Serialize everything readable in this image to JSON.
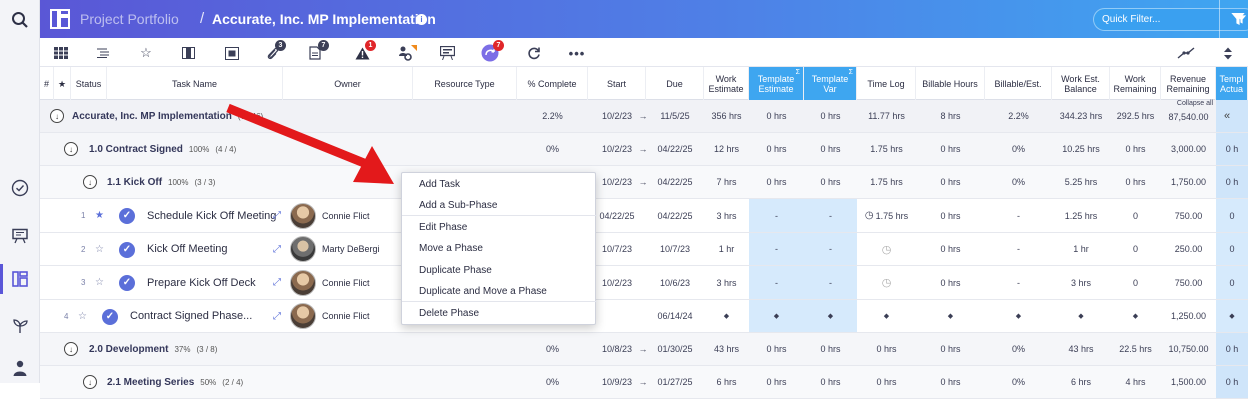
{
  "header": {
    "breadcrumb_root": "Project Portfolio",
    "separator": "/",
    "title": "Accurate, Inc. MP Implementation",
    "quick_filter_placeholder": "Quick Filter..."
  },
  "toolbar": {
    "badges": {
      "attachments": "3",
      "notes": "7",
      "risks": "1",
      "sync": "7"
    }
  },
  "columns": {
    "hash": "#",
    "star": "★",
    "status": "Status",
    "task_name": "Task Name",
    "owner": "Owner",
    "resource_type": "Resource Type",
    "pct_complete": "% Complete",
    "start": "Start",
    "due": "Due",
    "work_estimate": "Work Estimate",
    "template_estimate": "Template Estimate",
    "template_var": "Template Var",
    "time_log": "Time Log",
    "billable_hours": "Billable Hours",
    "billable_est": "Billable/Est.",
    "work_est_balance": "Work Est. Balance",
    "work_remaining": "Work Remaining",
    "revenue_remaining": "Revenue Remaining",
    "template_actual": "Templ Actua"
  },
  "project_row": {
    "name": "Accurate, Inc. MP Implementation",
    "counts": "(7 / 46)",
    "pct": "2.2%",
    "start": "10/2/23",
    "due": "11/5/25",
    "work_est": "356 hrs",
    "tpl_est": "0 hrs",
    "tpl_var": "0 hrs",
    "time_log": "11.77 hrs",
    "billable": "8 hrs",
    "billable_est": "2.2%",
    "balance": "344.23 hrs",
    "remaining": "292.5 hrs",
    "revenue": "87,540.00",
    "collapse_all": "Collapse all",
    "tpl_actual": "0"
  },
  "phases": [
    {
      "name": "1.0 Contract Signed",
      "pct_inline": "100%",
      "counts": "(4 / 4)",
      "pct": "0%",
      "start": "10/2/23",
      "due": "04/22/25",
      "work_est": "12 hrs",
      "tpl_est": "0 hrs",
      "tpl_var": "0 hrs",
      "time_log": "1.75 hrs",
      "billable": "0 hrs",
      "billable_est": "0%",
      "balance": "10.25 hrs",
      "remaining": "0 hrs",
      "revenue": "3,000.00",
      "tpl_actual": "0 h"
    },
    {
      "name": "1.1 Kick Off",
      "pct_inline": "100%",
      "counts": "(3 / 3)",
      "pct": "0%",
      "start": "10/2/23",
      "due": "04/22/25",
      "work_est": "7 hrs",
      "tpl_est": "0 hrs",
      "tpl_var": "0 hrs",
      "time_log": "1.75 hrs",
      "billable": "0 hrs",
      "billable_est": "0%",
      "balance": "5.25 hrs",
      "remaining": "0 hrs",
      "revenue": "1,750.00",
      "tpl_actual": "0 h"
    },
    {
      "name": "2.0 Development",
      "pct_inline": "37%",
      "counts": "(3 / 8)",
      "pct": "0%",
      "start": "10/8/23",
      "due": "01/30/25",
      "work_est": "43 hrs",
      "tpl_est": "0 hrs",
      "tpl_var": "0 hrs",
      "time_log": "0 hrs",
      "billable": "0 hrs",
      "billable_est": "0%",
      "balance": "43 hrs",
      "remaining": "22.5 hrs",
      "revenue": "10,750.00",
      "tpl_actual": "0 h"
    },
    {
      "name": "2.1 Meeting Series",
      "pct_inline": "50%",
      "counts": "(2 / 4)",
      "pct": "0%",
      "start": "10/9/23",
      "due": "01/27/25",
      "work_est": "6 hrs",
      "tpl_est": "0 hrs",
      "tpl_var": "0 hrs",
      "time_log": "0 hrs",
      "billable": "0 hrs",
      "billable_est": "0%",
      "balance": "6 hrs",
      "remaining": "4 hrs",
      "revenue": "1,500.00",
      "tpl_actual": "0 h"
    }
  ],
  "tasks": [
    {
      "num": "1",
      "name": "Schedule Kick Off Meeting",
      "owner": "Connie  Flict",
      "start": "04/22/25",
      "due": "04/22/25",
      "work_est": "3 hrs",
      "tpl_est": "-",
      "tpl_var": "-",
      "time_log": "1.75 hrs",
      "billable": "0 hrs",
      "billable_est": "-",
      "balance": "1.25 hrs",
      "remaining": "0",
      "revenue": "750.00",
      "tpl_actual": "0"
    },
    {
      "num": "2",
      "name": "Kick Off Meeting",
      "owner": "Marty DeBergi",
      "start": "10/7/23",
      "due": "10/7/23",
      "work_est": "1 hr",
      "tpl_est": "-",
      "tpl_var": "-",
      "time_log": "",
      "billable": "0 hrs",
      "billable_est": "-",
      "balance": "1 hr",
      "remaining": "0",
      "revenue": "250.00",
      "tpl_actual": "0"
    },
    {
      "num": "3",
      "name": "Prepare Kick Off Deck",
      "owner": "Connie  Flict",
      "start": "10/2/23",
      "due": "10/6/23",
      "work_est": "3 hrs",
      "tpl_est": "-",
      "tpl_var": "-",
      "time_log": "",
      "billable": "0 hrs",
      "billable_est": "-",
      "balance": "3 hrs",
      "remaining": "0",
      "revenue": "750.00",
      "tpl_actual": "0"
    },
    {
      "num": "4",
      "name": "Contract Signed Phase...",
      "owner": "Connie  Flict",
      "start": "",
      "due": "06/14/24",
      "work_est": "◆",
      "tpl_est": "◆",
      "tpl_var": "◆",
      "time_log": "◆",
      "billable": "◆",
      "billable_est": "◆",
      "balance": "◆",
      "remaining": "◆",
      "revenue": "1,250.00",
      "tpl_actual": "◆"
    }
  ],
  "context_menu": {
    "items": [
      "Add Task",
      "Add a Sub-Phase",
      "Edit Phase",
      "Move a Phase",
      "Duplicate Phase",
      "Duplicate and Move a Phase",
      "Delete Phase"
    ]
  },
  "colors": {
    "header_start": "#5a57d6",
    "header_end": "#3fa6f1",
    "template_col": "#3ea6f0",
    "arrow": "#e3191b",
    "check": "#5b6fd9"
  }
}
